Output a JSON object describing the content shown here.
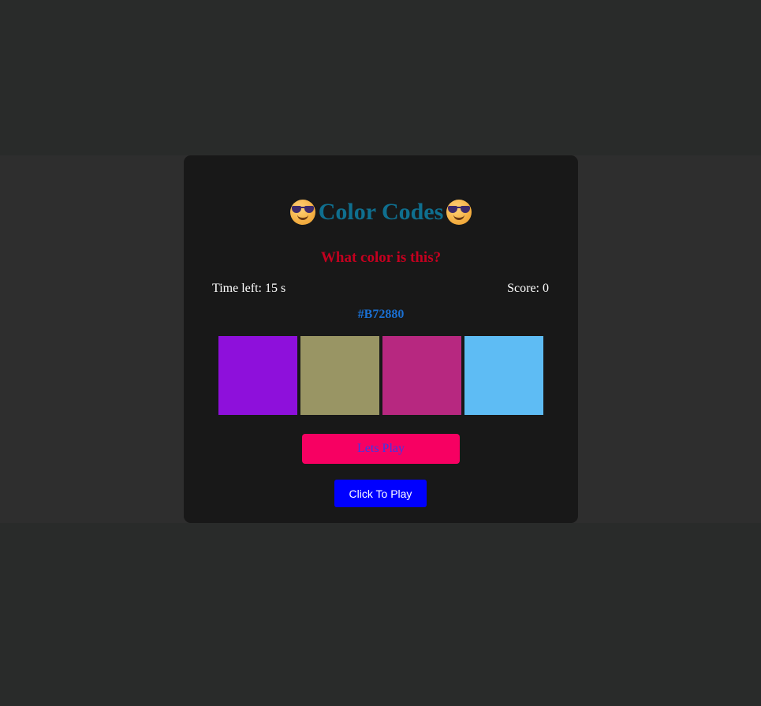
{
  "header": {
    "title": "Color Codes",
    "emoji_left": "smiling-face-with-sunglasses-icon",
    "emoji_right": "smiling-face-with-sunglasses-icon"
  },
  "game": {
    "question": "What color is this?",
    "time_label": "Time left: 15 s",
    "score_label": "Score:",
    "score_value": "0",
    "target_hex": "#B72880",
    "options": [
      {
        "color": "#8e10db"
      },
      {
        "color": "#999564"
      },
      {
        "color": "#b72880"
      },
      {
        "color": "#5ebcf4"
      }
    ]
  },
  "buttons": {
    "lets_play": "Lets Play",
    "click_to_play": "Click To Play"
  },
  "colors": {
    "page_background": "#292b2a",
    "band_background": "#2e2e2e",
    "card_background": "#181818",
    "title_color": "#0f6f8f",
    "question_color": "#c4001f",
    "hex_color": "#1a6fd1",
    "lets_play_bg": "#f70062",
    "click_to_play_bg": "#0000ff"
  }
}
